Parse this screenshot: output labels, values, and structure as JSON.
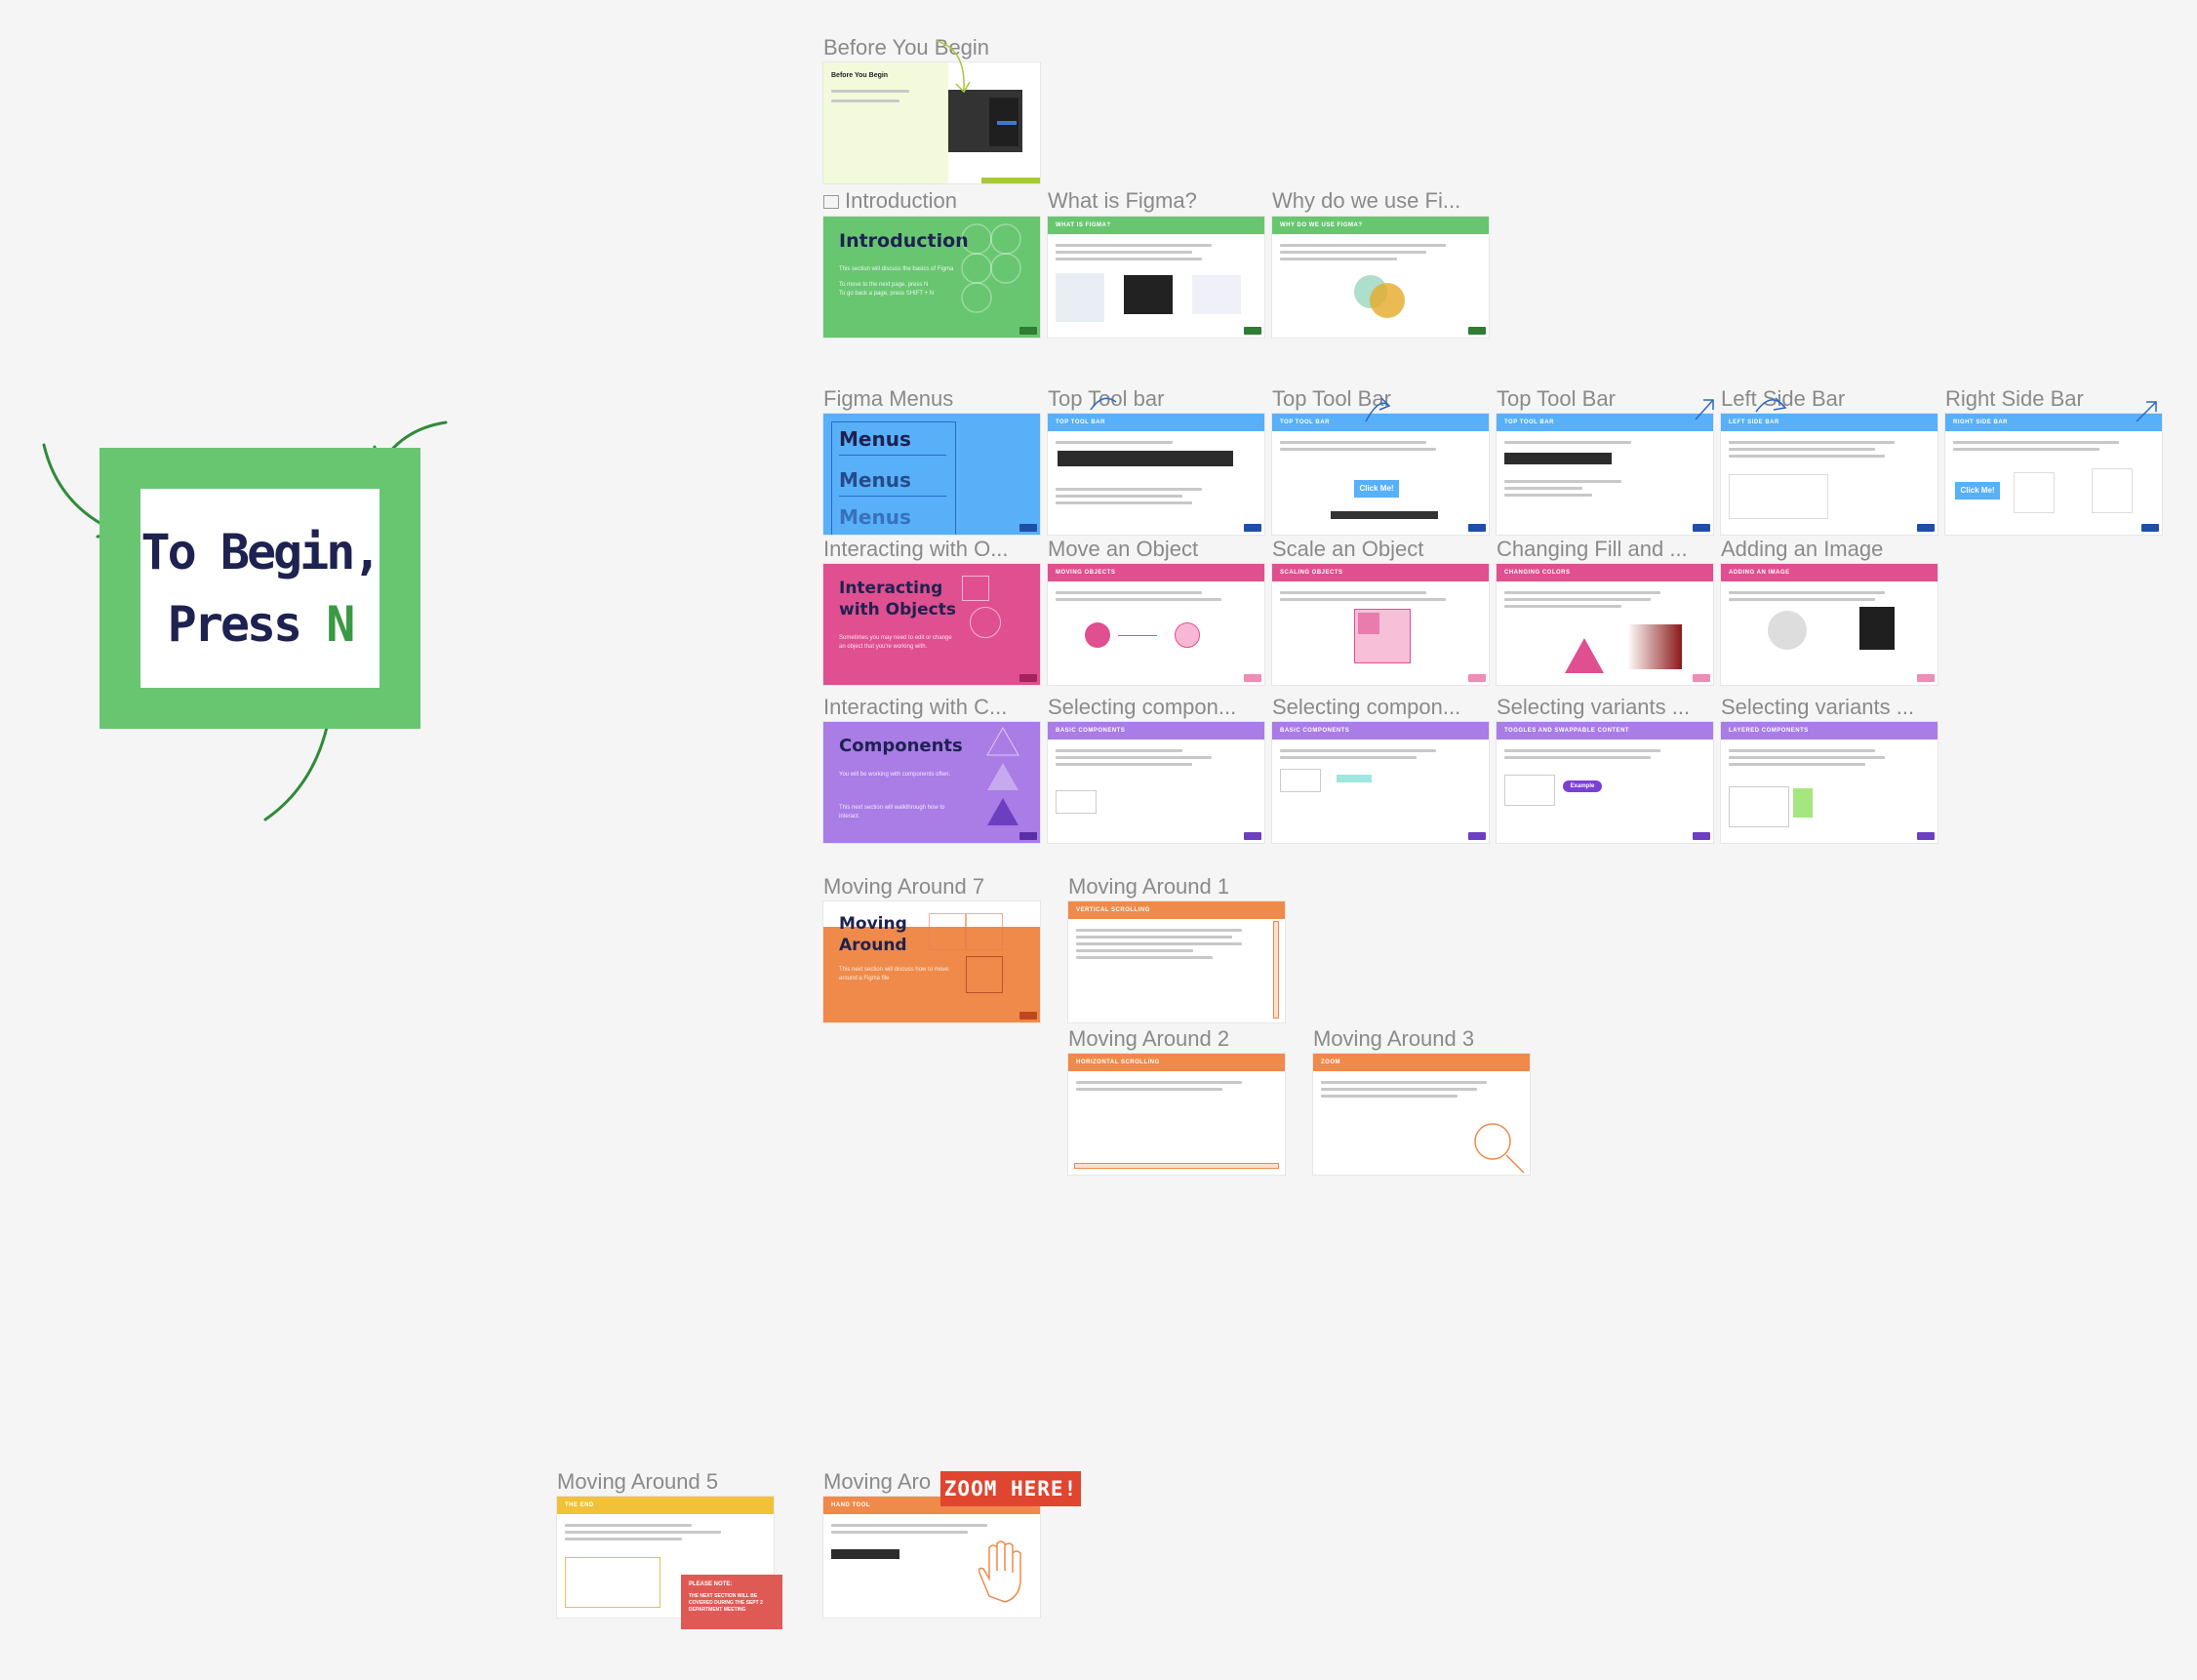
{
  "begin": {
    "line1": "To Begin,",
    "line2_prefix": "Press ",
    "key": "N"
  },
  "colors": {
    "green": "#68c670",
    "blue": "#57b0f8",
    "pink": "#e04f8f",
    "purple": "#a97ce6",
    "orange": "#ef8a4a",
    "yellow": "#f2c13a",
    "arrow": "#2e8b3a"
  },
  "frames": {
    "before": "Before You Begin",
    "intro": "Introduction",
    "what_figma": "What is Figma?",
    "why_figma": "Why do we use Fi...",
    "menus": "Figma Menus",
    "top1": "Top Tool bar",
    "top2": "Top Tool Bar",
    "top3": "Top Tool Bar",
    "left": "Left Side Bar",
    "right": "Right Side Bar",
    "interacting_o": "Interacting with O...",
    "move": "Move an Object",
    "scale": "Scale an Object",
    "changing": "Changing Fill and ...",
    "adding": "Adding an Image",
    "interacting_c": "Interacting with C...",
    "sel_comp1": "Selecting compon...",
    "sel_comp2": "Selecting compon...",
    "sel_var1": "Selecting variants ...",
    "sel_var2": "Selecting variants ...",
    "moving7": "Moving Around 7",
    "moving1": "Moving Around 1",
    "moving2": "Moving Around 2",
    "moving3": "Moving Around 3",
    "moving5": "Moving Around 5",
    "moving_ar": "Moving Aro"
  },
  "cards": {
    "intro_title": "Introduction",
    "menus_title": "Menus",
    "menus_title2": "Menus",
    "menus_title3": "Menus",
    "interacting_title": "Interacting with Objects",
    "components_title": "Components",
    "moving_title": "Moving Around",
    "before_title": "Before You Begin",
    "hdr_what": "WHAT IS FIGMA?",
    "hdr_why": "WHY DO WE USE FIGMA?",
    "hdr_top": "TOP TOOL BAR",
    "hdr_left": "LEFT SIDE BAR",
    "hdr_right": "RIGHT SIDE BAR",
    "hdr_move": "MOVING OBJECTS",
    "hdr_scale": "SCALING OBJECTS",
    "hdr_change": "CHANGING COLORS",
    "hdr_adding": "ADDING AN IMAGE",
    "hdr_basic": "BASIC COMPONENTS",
    "hdr_toggles": "TOGGLES AND SWAPPABLE CONTENT",
    "hdr_layered": "LAYERED COMPONENTS",
    "hdr_vscroll": "VERTICAL SCROLLING",
    "hdr_hscroll": "HORIZONTAL SCROLLING",
    "hdr_zoom": "ZOOM",
    "hdr_end": "THE END",
    "hdr_hand": "HAND TOOL",
    "click_me": "Click Me!",
    "example": "Example"
  },
  "zoom_badge": "ZOOM HERE!",
  "please_note": {
    "title": "PLEASE NOTE:",
    "text": "THE NEXT SECTION WILL BE COVERED DURING THE SEPT 2 DEPARTMENT MEETING"
  }
}
